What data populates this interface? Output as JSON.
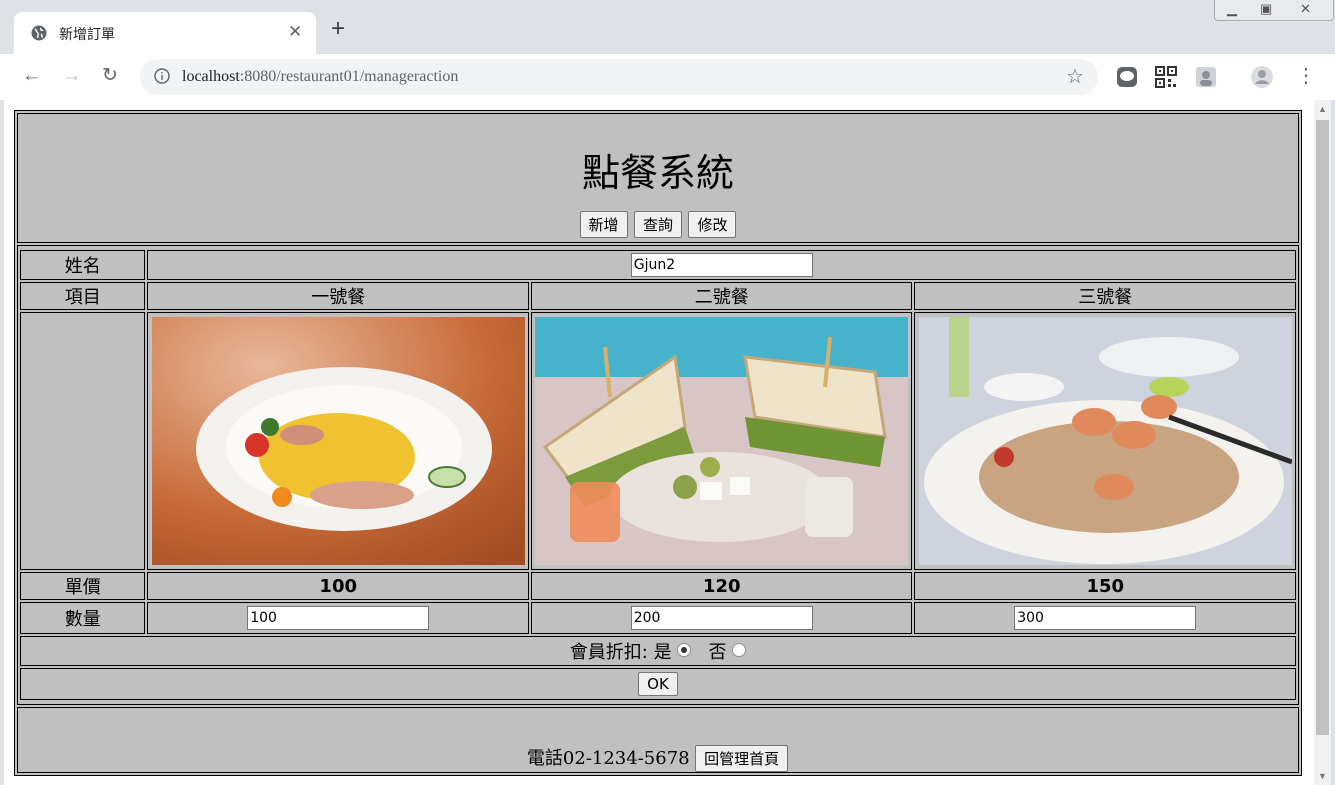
{
  "browser": {
    "tab_title": "新增訂單",
    "url_host": "localhost",
    "url_rest": ":8080/restaurant01/manageraction"
  },
  "page": {
    "title": "點餐系統",
    "nav_buttons": [
      "新增",
      "查詢",
      "修改"
    ],
    "labels": {
      "name": "姓名",
      "item": "項目",
      "price": "單價",
      "quantity": "數量",
      "discount": "會員折扣:",
      "yes": "是",
      "no": "否",
      "ok": "OK"
    },
    "name_value": "Gjun2",
    "meals": [
      {
        "name": "一號餐",
        "price": "100",
        "quantity": "100",
        "photo": "pasta-plate"
      },
      {
        "name": "二號餐",
        "price": "120",
        "quantity": "200",
        "photo": "club-sandwich"
      },
      {
        "name": "三號餐",
        "price": "150",
        "quantity": "300",
        "photo": "shrimp-pad-thai"
      }
    ],
    "discount_selected": "是",
    "footer_phone": "電話02-1234-5678",
    "footer_button": "回管理首頁"
  }
}
